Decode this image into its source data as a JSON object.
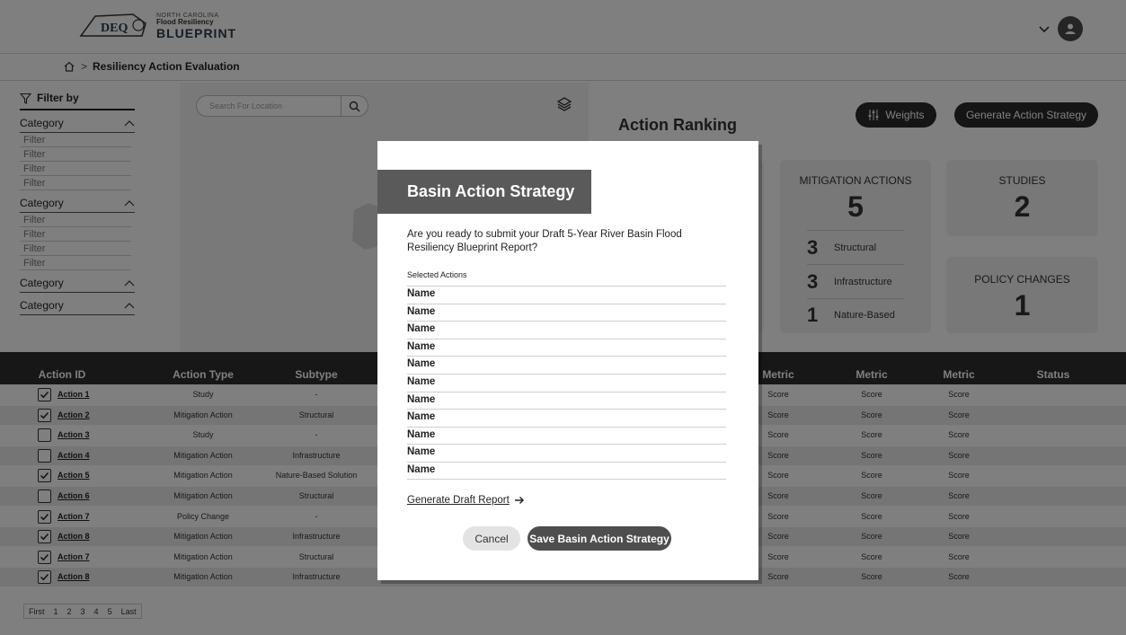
{
  "logo": {
    "line1": "NORTH CAROLINA",
    "line2": "Flood Resiliency",
    "line3": "BLUEPRINT",
    "mark": "DEQ"
  },
  "breadcrumb": {
    "current": "Resiliency Action Evaluation",
    "separator": ">"
  },
  "filters": {
    "title": "Filter by",
    "groups": [
      {
        "label": "Category",
        "items": [
          "Filter",
          "Filter",
          "Filter",
          "Filter"
        ]
      },
      {
        "label": "Category",
        "items": [
          "Filter",
          "Filter",
          "Filter",
          "Filter"
        ]
      },
      {
        "label": "Category",
        "items": []
      },
      {
        "label": "Category",
        "items": []
      }
    ]
  },
  "map": {
    "search_placeholder": "Search For Location"
  },
  "ranking": {
    "title": "Action Ranking",
    "weights_label": "Weights",
    "strategy_label": "Generate Action Strategy",
    "mitigation": {
      "label": "MITIGATION ACTIONS",
      "value": "5",
      "breakdown": [
        {
          "count": "3",
          "label": "Structural"
        },
        {
          "count": "3",
          "label": "Infrastructure"
        },
        {
          "count": "1",
          "label": "Nature-Based"
        }
      ]
    },
    "studies": {
      "label": "STUDIES",
      "value": "2"
    },
    "policy": {
      "label": "POLICY CHANGES",
      "value": "1"
    }
  },
  "table": {
    "headers": [
      "Action ID",
      "Action Type",
      "Subtype",
      "Metric",
      "Metric",
      "Metric",
      "Status"
    ],
    "rows": [
      {
        "checked": true,
        "id": "Action 1",
        "type": "Study",
        "subtype": "-",
        "m1": "Score",
        "m2": "Score",
        "m3": "Score"
      },
      {
        "checked": true,
        "id": "Action 2",
        "type": "Mitigation Action",
        "subtype": "Structural",
        "m1": "Score",
        "m2": "Score",
        "m3": "Score"
      },
      {
        "checked": false,
        "id": "Action 3",
        "type": "Study",
        "subtype": "-",
        "m1": "Score",
        "m2": "Score",
        "m3": "Score"
      },
      {
        "checked": false,
        "id": "Action 4",
        "type": "Mitigation Action",
        "subtype": "Infrastructure",
        "m1": "Score",
        "m2": "Score",
        "m3": "Score"
      },
      {
        "checked": true,
        "id": "Action 5",
        "type": "Mitigation Action",
        "subtype": "Nature-Based Solution",
        "m1": "Score",
        "m2": "Score",
        "m3": "Score"
      },
      {
        "checked": false,
        "id": "Action 6",
        "type": "Mitigation Action",
        "subtype": "Structural",
        "m1": "Score",
        "m2": "Score",
        "m3": "Score"
      },
      {
        "checked": true,
        "id": "Action 7",
        "type": "Policy Change",
        "subtype": "-",
        "m1": "Score",
        "m2": "Score",
        "m3": "Score"
      },
      {
        "checked": true,
        "id": "Action 8",
        "type": "Mitigation Action",
        "subtype": "Infrastructure",
        "m1": "Score",
        "m2": "Score",
        "m3": "Score"
      },
      {
        "checked": true,
        "id": "Action 7",
        "type": "Mitigation Action",
        "subtype": "Structural",
        "m1": "Score",
        "m2": "Score",
        "m3": "Score"
      },
      {
        "checked": true,
        "id": "Action 8",
        "type": "Mitigation Action",
        "subtype": "Infrastructure",
        "m1": "Score",
        "m2": "Score",
        "m3": "Score"
      }
    ]
  },
  "pagination": [
    "First",
    "1",
    "2",
    "3",
    "4",
    "5",
    "Last"
  ],
  "modal": {
    "title": "Basin Action Strategy",
    "question": "Are you ready to submit your Draft 5-Year River Basin Flood Resiliency Blueprint Report?",
    "selected_label": "Selected Actions",
    "names": [
      "Name",
      "Name",
      "Name",
      "Name",
      "Name",
      "Name",
      "Name",
      "Name",
      "Name",
      "Name",
      "Name"
    ],
    "draft_link": "Generate Draft Report",
    "cancel": "Cancel",
    "save": "Save Basin Action Strategy"
  }
}
